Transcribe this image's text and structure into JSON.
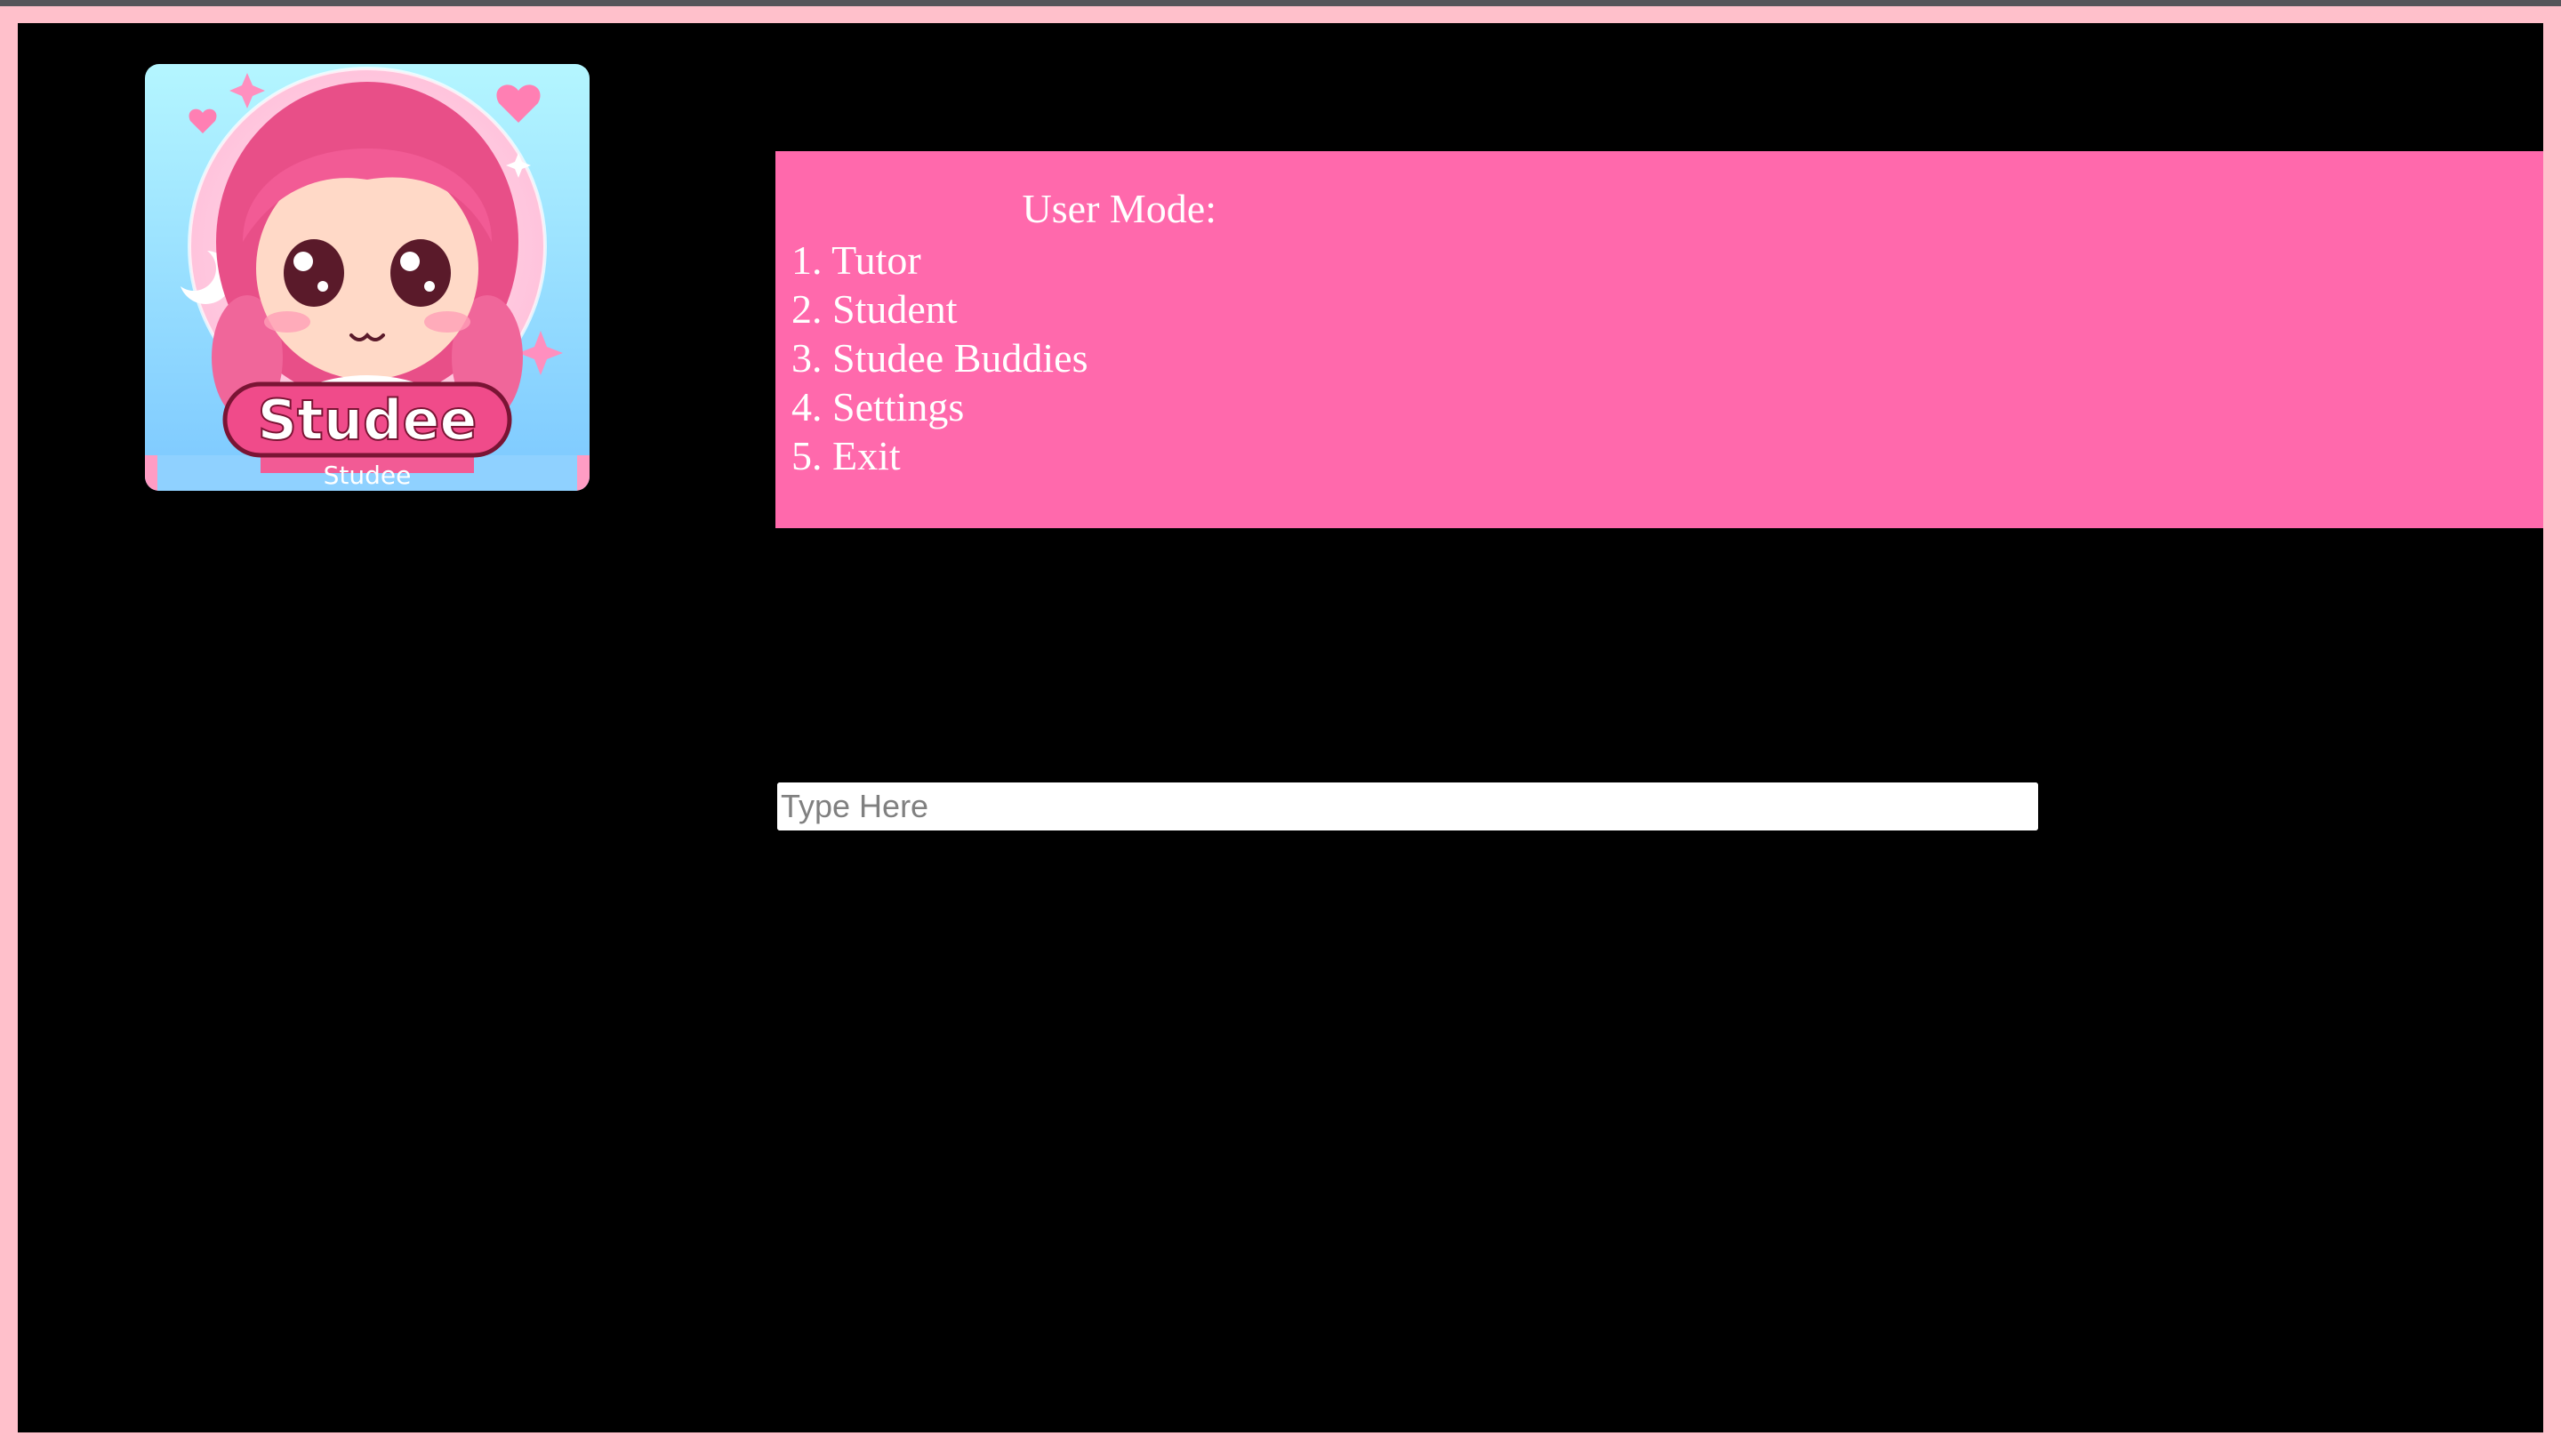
{
  "logo": {
    "badge_text": "Studee",
    "caption": "Studee"
  },
  "menu": {
    "title": "User Mode:",
    "items": [
      {
        "label": "1. Tutor"
      },
      {
        "label": "2. Student"
      },
      {
        "label": "3. Studee Buddies"
      },
      {
        "label": "4. Settings"
      },
      {
        "label": "5. Exit"
      }
    ]
  },
  "input": {
    "placeholder": "Type Here",
    "value": ""
  },
  "colors": {
    "frame": "#ffc0cb",
    "background": "#000000",
    "panel": "#ff69ac",
    "panel_text": "#ffffff"
  }
}
